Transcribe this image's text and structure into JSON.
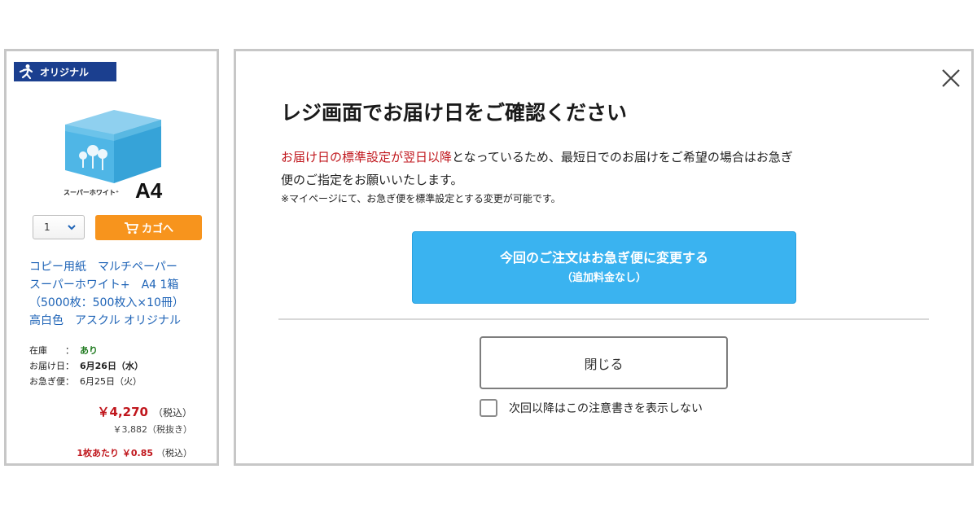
{
  "product": {
    "brand_badge": "オリジナル",
    "image_sublabel": "スーパーホワイト⁺",
    "size_label": "A4",
    "quantity": "1",
    "cart_button_label": "カゴへ",
    "title": "コピー用紙　マルチペーパー\nスーパーホワイト+　A4 1箱\n（5000枚：500枚入×10冊）\n高白色　アスクル オリジナル",
    "stock_key": "在庫　　：",
    "stock_value": "あり",
    "delivery_key": "お届け日：",
    "delivery_value": "6月26日（水）",
    "express_key": "お急ぎ便：",
    "express_value": "6月25日（火）",
    "price_incl": "￥4,270",
    "price_incl_tax": "（税込）",
    "price_excl": "￥3,882（税抜き）",
    "unit_price": "1枚あたり ￥0.85",
    "unit_price_tax": "（税込）"
  },
  "modal": {
    "title": "レジ画面でお届け日をご確認ください",
    "body_emphasis": "お届け日の標準設定が翌日以降",
    "body_line1_rest": "となっているため、最短日でのお届けをご希望の場合はお急ぎ",
    "body_line2": "便のご指定をお願いいたします。",
    "note": "※マイページにて、お急ぎ便を標準設定とする変更が可能です。",
    "express_button_line1": "今回のご注文はお急ぎ便に変更する",
    "express_button_line2": "（追加料金なし）",
    "close_button_label": "閉じる",
    "dont_show_label": "次回以降はこの注意書きを表示しない"
  },
  "colors": {
    "accent_blue": "#3ab3f0",
    "cart_orange": "#f7941d",
    "price_red": "#c0161c",
    "link_blue": "#1f64b7",
    "badge_navy": "#1b3f8f"
  },
  "icons": [
    "runner-logo-icon",
    "chevron-down-icon",
    "cart-icon",
    "close-icon"
  ]
}
